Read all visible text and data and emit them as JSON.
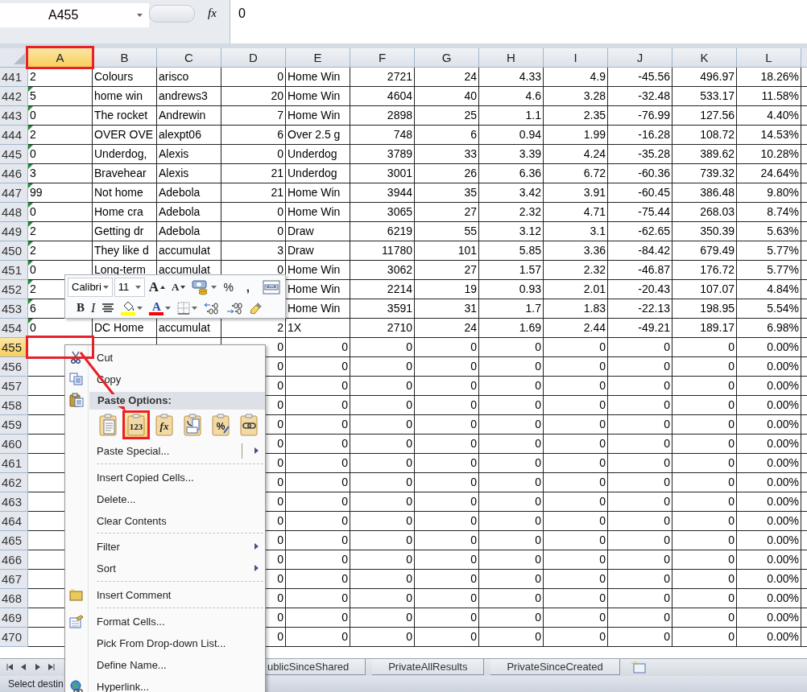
{
  "formula_bar": {
    "name_box": "A455",
    "fx": "fx",
    "value": "0"
  },
  "columns": [
    {
      "label": "A",
      "kind": "text",
      "selected": true,
      "annotated": true
    },
    {
      "label": "B",
      "kind": "text",
      "selected": false,
      "annotated": false
    },
    {
      "label": "C",
      "kind": "text",
      "selected": false,
      "annotated": false
    },
    {
      "label": "D",
      "kind": "number",
      "selected": false,
      "annotated": false
    },
    {
      "label": "E",
      "kind": "text",
      "selected": false,
      "annotated": false
    },
    {
      "label": "F",
      "kind": "number",
      "selected": false,
      "annotated": false
    },
    {
      "label": "G",
      "kind": "number",
      "selected": false,
      "annotated": false
    },
    {
      "label": "H",
      "kind": "number",
      "selected": false,
      "annotated": false
    },
    {
      "label": "I",
      "kind": "number",
      "selected": false,
      "annotated": false
    },
    {
      "label": "J",
      "kind": "number",
      "selected": false,
      "annotated": false
    },
    {
      "label": "K",
      "kind": "number",
      "selected": false,
      "annotated": false
    },
    {
      "label": "L",
      "kind": "number",
      "selected": false,
      "annotated": false
    }
  ],
  "rows": [
    {
      "number": "441",
      "selected": false,
      "warning": false,
      "annotated": false,
      "cells": [
        "2",
        "Colours",
        "arisco",
        "0",
        "Home Win",
        "2721",
        "24",
        "4.33",
        "4.9",
        "-45.56",
        "496.97",
        "18.26%"
      ]
    },
    {
      "number": "442",
      "selected": false,
      "warning": true,
      "annotated": false,
      "cells": [
        "5",
        "home win",
        "andrews3",
        "20",
        "Home Win",
        "4604",
        "40",
        "4.6",
        "3.28",
        "-32.48",
        "533.17",
        "11.58%"
      ]
    },
    {
      "number": "443",
      "selected": false,
      "warning": true,
      "annotated": false,
      "cells": [
        "0",
        "The rocket",
        "Andrewin",
        "7",
        "Home Win",
        "2898",
        "25",
        "1.1",
        "2.35",
        "-76.99",
        "127.56",
        "4.40%"
      ]
    },
    {
      "number": "444",
      "selected": false,
      "warning": true,
      "annotated": false,
      "cells": [
        "2",
        "OVER OVE",
        "alexpt06",
        "6",
        "Over 2.5 g",
        "748",
        "6",
        "0.94",
        "1.99",
        "-16.28",
        "108.72",
        "14.53%"
      ]
    },
    {
      "number": "445",
      "selected": false,
      "warning": true,
      "annotated": false,
      "cells": [
        "0",
        "Underdog,",
        "Alexis",
        "0",
        "Underdog",
        "3789",
        "33",
        "3.39",
        "4.24",
        "-35.28",
        "389.62",
        "10.28%"
      ]
    },
    {
      "number": "446",
      "selected": false,
      "warning": true,
      "annotated": false,
      "cells": [
        "3",
        "Bravehear",
        "Alexis",
        "21",
        "Underdog",
        "3001",
        "26",
        "6.36",
        "6.72",
        "-60.36",
        "739.32",
        "24.64%"
      ]
    },
    {
      "number": "447",
      "selected": false,
      "warning": true,
      "annotated": false,
      "cells": [
        "99",
        "Not home",
        "Adebola",
        "21",
        "Home Win",
        "3944",
        "35",
        "3.42",
        "3.91",
        "-60.45",
        "386.48",
        "9.80%"
      ]
    },
    {
      "number": "448",
      "selected": false,
      "warning": true,
      "annotated": false,
      "cells": [
        "0",
        "Home cra",
        "Adebola",
        "0",
        "Home Win",
        "3065",
        "27",
        "2.32",
        "4.71",
        "-75.44",
        "268.03",
        "8.74%"
      ]
    },
    {
      "number": "449",
      "selected": false,
      "warning": true,
      "annotated": false,
      "cells": [
        "2",
        "Getting dr",
        "Adebola",
        "0",
        "Draw",
        "6219",
        "55",
        "3.12",
        "3.1",
        "-62.65",
        "350.39",
        "5.63%"
      ]
    },
    {
      "number": "450",
      "selected": false,
      "warning": true,
      "annotated": false,
      "cells": [
        "2",
        "They like d",
        "accumulat",
        "3",
        "Draw",
        "11780",
        "101",
        "5.85",
        "3.36",
        "-84.42",
        "679.49",
        "5.77%"
      ]
    },
    {
      "number": "451",
      "selected": false,
      "warning": true,
      "annotated": false,
      "cells": [
        "0",
        "Long-term",
        "accumulat",
        "0",
        "Home Win",
        "3062",
        "27",
        "1.57",
        "2.32",
        "-46.87",
        "176.72",
        "5.77%"
      ]
    },
    {
      "number": "452",
      "selected": false,
      "warning": true,
      "annotated": false,
      "cells": [
        "2"
      ],
      "tail": [
        "Home Win",
        "2214",
        "19",
        "0.93",
        "2.01",
        "-20.43",
        "107.07",
        "4.84%"
      ]
    },
    {
      "number": "453",
      "selected": false,
      "warning": true,
      "annotated": false,
      "cells": [
        "6"
      ],
      "tail": [
        "Home Win",
        "3591",
        "31",
        "1.7",
        "1.83",
        "-22.13",
        "198.95",
        "5.54%"
      ]
    },
    {
      "number": "454",
      "selected": false,
      "warning": true,
      "annotated": false,
      "cells": [
        "0",
        "DC Home",
        "accumulat",
        "2",
        "1X",
        "2710",
        "24",
        "1.69",
        "2.44",
        "-49.21",
        "189.17",
        "6.98%"
      ]
    },
    {
      "number": "455",
      "kind": "formula",
      "selected": true,
      "annotated": true,
      "tail": [
        "0",
        "0",
        "0",
        "0",
        "0",
        "0",
        "0",
        "0",
        "0.00%"
      ]
    },
    {
      "number": "456",
      "kind": "formula",
      "selected": false,
      "annotated": false,
      "tail": [
        "0",
        "0",
        "0",
        "0",
        "0",
        "0",
        "0",
        "0",
        "0.00%"
      ]
    },
    {
      "number": "457",
      "kind": "formula",
      "selected": false,
      "annotated": false,
      "tail": [
        "0",
        "0",
        "0",
        "0",
        "0",
        "0",
        "0",
        "0",
        "0.00%"
      ]
    },
    {
      "number": "458",
      "kind": "formula",
      "selected": false,
      "annotated": false,
      "tail": [
        "0",
        "0",
        "0",
        "0",
        "0",
        "0",
        "0",
        "0",
        "0.00%"
      ]
    },
    {
      "number": "459",
      "kind": "formula",
      "selected": false,
      "annotated": false,
      "tail": [
        "0",
        "0",
        "0",
        "0",
        "0",
        "0",
        "0",
        "0",
        "0.00%"
      ]
    },
    {
      "number": "460",
      "kind": "formula",
      "selected": false,
      "annotated": false,
      "tail": [
        "0",
        "0",
        "0",
        "0",
        "0",
        "0",
        "0",
        "0",
        "0.00%"
      ]
    },
    {
      "number": "461",
      "kind": "formula",
      "selected": false,
      "annotated": false,
      "tail": [
        "0",
        "0",
        "0",
        "0",
        "0",
        "0",
        "0",
        "0",
        "0.00%"
      ]
    },
    {
      "number": "462",
      "kind": "formula",
      "selected": false,
      "annotated": false,
      "tail": [
        "0",
        "0",
        "0",
        "0",
        "0",
        "0",
        "0",
        "0",
        "0.00%"
      ]
    },
    {
      "number": "463",
      "kind": "formula",
      "selected": false,
      "annotated": false,
      "tail": [
        "0",
        "0",
        "0",
        "0",
        "0",
        "0",
        "0",
        "0",
        "0.00%"
      ]
    },
    {
      "number": "464",
      "kind": "formula",
      "selected": false,
      "annotated": false,
      "tail": [
        "0",
        "0",
        "0",
        "0",
        "0",
        "0",
        "0",
        "0",
        "0.00%"
      ]
    },
    {
      "number": "465",
      "kind": "formula",
      "selected": false,
      "annotated": false,
      "tail": [
        "0",
        "0",
        "0",
        "0",
        "0",
        "0",
        "0",
        "0",
        "0.00%"
      ]
    },
    {
      "number": "466",
      "kind": "formula",
      "selected": false,
      "annotated": false,
      "tail": [
        "0",
        "0",
        "0",
        "0",
        "0",
        "0",
        "0",
        "0",
        "0.00%"
      ]
    },
    {
      "number": "467",
      "kind": "formula",
      "selected": false,
      "annotated": false,
      "tail": [
        "0",
        "0",
        "0",
        "0",
        "0",
        "0",
        "0",
        "0",
        "0.00%"
      ]
    },
    {
      "number": "468",
      "kind": "formula",
      "selected": false,
      "annotated": false,
      "tail": [
        "0",
        "0",
        "0",
        "0",
        "0",
        "0",
        "0",
        "0",
        "0.00%"
      ]
    },
    {
      "number": "469",
      "kind": "formula",
      "selected": false,
      "annotated": false,
      "tail": [
        "0",
        "0",
        "0",
        "0",
        "0",
        "0",
        "0",
        "0",
        "0.00%"
      ]
    },
    {
      "number": "470",
      "kind": "formula",
      "selected": false,
      "annotated": false,
      "tail": [
        "0",
        "0",
        "0",
        "0",
        "0",
        "0",
        "0",
        "0",
        "0.00%"
      ]
    }
  ],
  "mini_toolbar": {
    "font": "Calibri",
    "size": "11",
    "row1": [
      {
        "kind": "grow-font",
        "glyph": "A"
      },
      {
        "kind": "shrink-font",
        "glyph": "A"
      },
      {
        "kind": "accounting"
      },
      {
        "kind": "percent",
        "glyph": "%"
      },
      {
        "kind": "comma",
        "glyph": ","
      },
      {
        "kind": "merge"
      }
    ],
    "row2": [
      {
        "kind": "bold",
        "glyph": "B"
      },
      {
        "kind": "italic",
        "glyph": "I"
      },
      {
        "kind": "center"
      },
      {
        "kind": "fill-color",
        "color": "#ffff00"
      },
      {
        "kind": "font-color",
        "glyph": "A",
        "color": "#ff0000"
      },
      {
        "kind": "borders"
      },
      {
        "kind": "increase-decimal"
      },
      {
        "kind": "decrease-decimal"
      },
      {
        "kind": "format-painter"
      }
    ]
  },
  "context_menu": {
    "items": [
      {
        "kind": "cut",
        "label": "Cut"
      },
      {
        "kind": "copy",
        "label": "Copy"
      },
      {
        "kind": "header",
        "label": "Paste Options:"
      },
      {
        "kind": "options",
        "options": [
          {
            "kind": "paste",
            "hovered": false,
            "annotated": false
          },
          {
            "kind": "values",
            "glyph": "123",
            "hovered": true,
            "annotated": true
          },
          {
            "kind": "formulas",
            "glyph": "fx",
            "hovered": false,
            "annotated": false
          },
          {
            "kind": "transpose",
            "hovered": false,
            "annotated": false
          },
          {
            "kind": "formatting",
            "glyph": "%",
            "hovered": false,
            "annotated": false
          },
          {
            "kind": "link",
            "hovered": false,
            "annotated": false
          }
        ]
      },
      {
        "kind": "split-submenu",
        "label": "Paste Special..."
      },
      {
        "kind": "separator"
      },
      {
        "kind": "plain",
        "label": "Insert Copied Cells..."
      },
      {
        "kind": "plain",
        "label": "Delete..."
      },
      {
        "kind": "plain",
        "label": "Clear Contents"
      },
      {
        "kind": "separator"
      },
      {
        "kind": "submenu",
        "label": "Filter"
      },
      {
        "kind": "submenu",
        "label": "Sort"
      },
      {
        "kind": "separator"
      },
      {
        "kind": "comment",
        "label": "Insert Comment"
      },
      {
        "kind": "separator"
      },
      {
        "kind": "format",
        "label": "Format Cells..."
      },
      {
        "kind": "plain",
        "label": "Pick From Drop-down List..."
      },
      {
        "kind": "plain",
        "label": "Define Name..."
      },
      {
        "kind": "link",
        "label": "Hyperlink..."
      }
    ]
  },
  "sheet_tabs": [
    {
      "label": "ublicSinceShared",
      "selected": false
    },
    {
      "label": "PrivateAllResults",
      "selected": false
    },
    {
      "label": "PrivateSinceCreated",
      "selected": false
    }
  ],
  "status_bar": {
    "text": "Select destin"
  },
  "annotation_arrow": true
}
